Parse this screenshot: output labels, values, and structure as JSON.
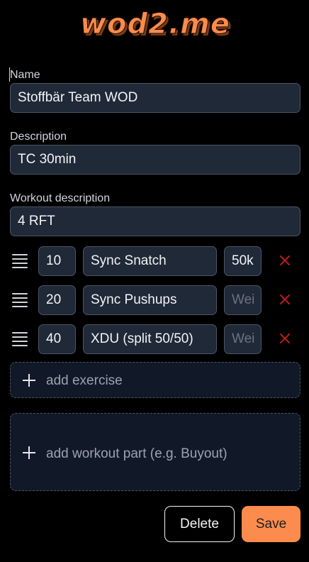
{
  "logo": {
    "text": "wod2.me"
  },
  "form": {
    "name": {
      "label": "Name",
      "value": "Stoffbär Team WOD"
    },
    "description": {
      "label": "Description",
      "value": "TC 30min"
    },
    "workout_description": {
      "label": "Workout description",
      "value": "4 RFT"
    }
  },
  "exercises": [
    {
      "reps": "10",
      "name": "Sync Snatch",
      "weight": "50k",
      "weight_placeholder": ""
    },
    {
      "reps": "20",
      "name": "Sync Pushups",
      "weight": "",
      "weight_placeholder": "Wei"
    },
    {
      "reps": "40",
      "name": "XDU (split 50/50)",
      "weight": "",
      "weight_placeholder": "Wei"
    }
  ],
  "actions": {
    "add_exercise": "add exercise",
    "add_part": "add workout part (e.g. Buyout)",
    "delete": "Delete",
    "save": "Save"
  },
  "colors": {
    "accent": "#fb8c4e",
    "delete_x": "#b91c1c",
    "input_bg": "#1f2937"
  },
  "icons": {
    "drag": "drag-handle-icon",
    "remove": "close-icon",
    "add": "plus-icon"
  }
}
